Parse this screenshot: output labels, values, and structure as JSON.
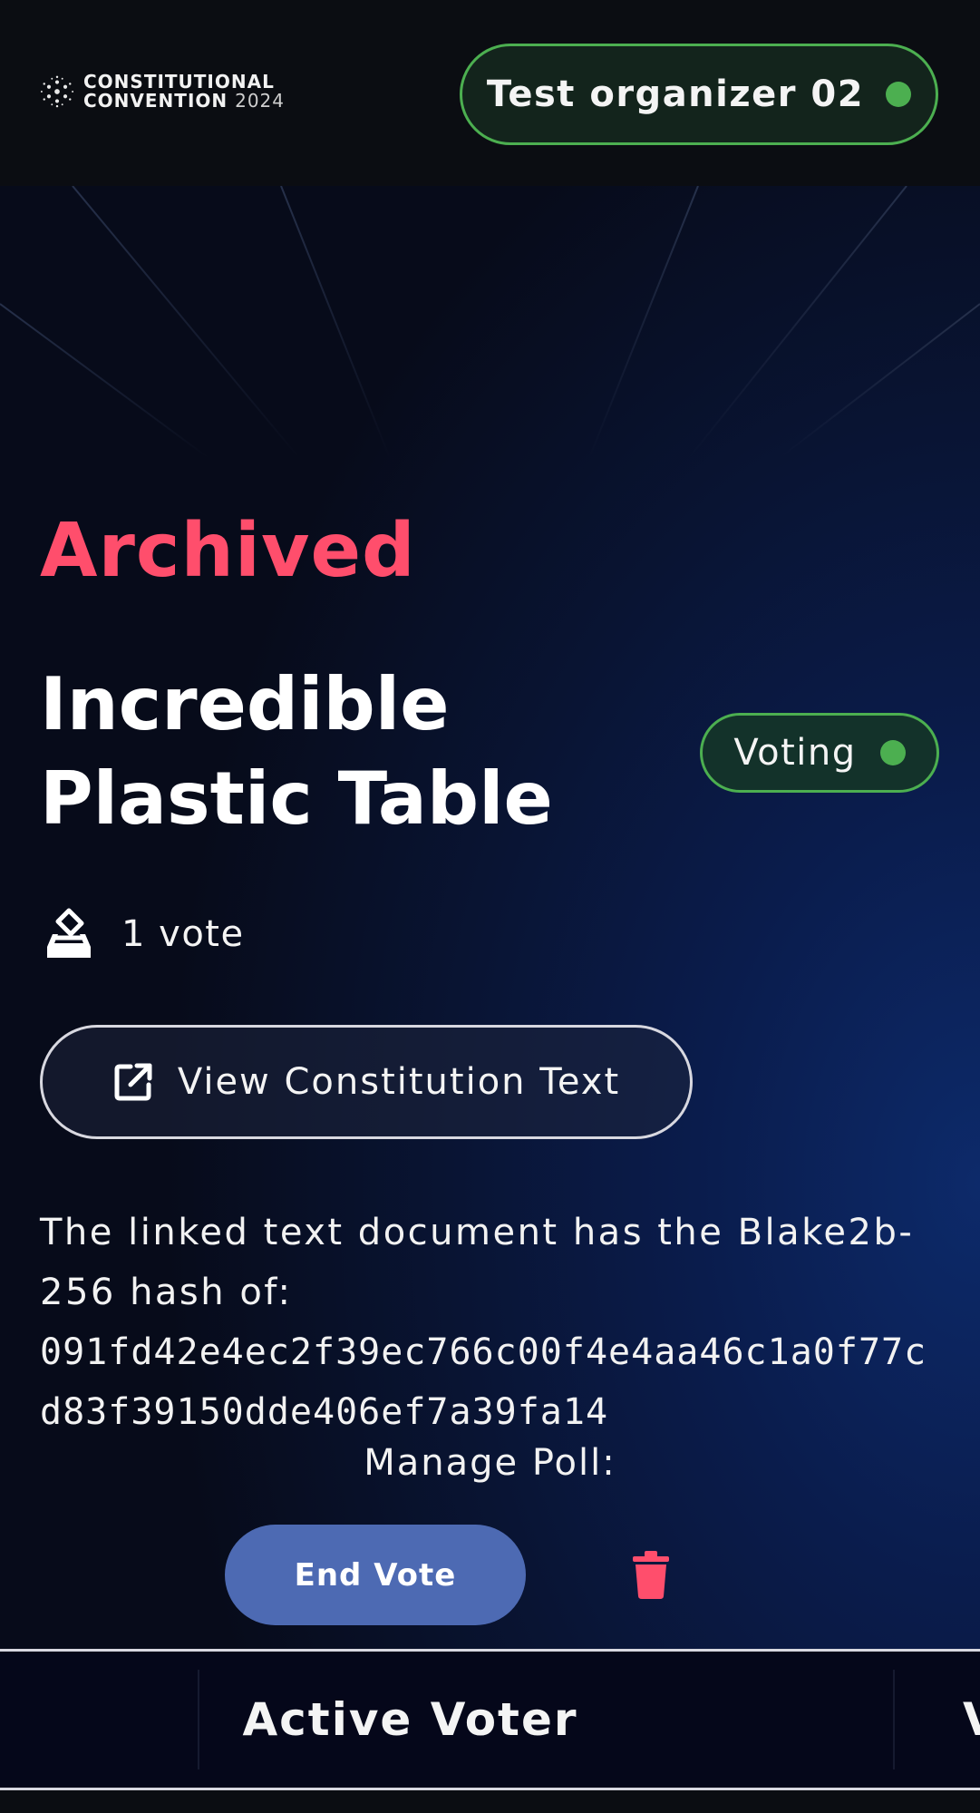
{
  "header": {
    "logo_line1": "CONSTITUTIONAL",
    "logo_line2": "CONVENTION",
    "logo_year": "2024",
    "organizer_name": "Test organizer 02",
    "status_color": "#4caf50"
  },
  "poll": {
    "state": "Archived",
    "title": "Incredible Plastic Table",
    "phase": "Voting",
    "vote_count": "1 vote",
    "view_button_label": "View Constitution Text",
    "hash_intro": "The linked text document has the Blake2b-256 hash of:",
    "hash_value": "091fd42e4ec2f39ec766c00f4e4aa46c1a0f77cd83f39150dde406ef7a39fa14"
  },
  "manage": {
    "label": "Manage Poll:",
    "end_vote_label": "End Vote"
  },
  "tabs": {
    "active": "Active Voter",
    "next": "V"
  },
  "colors": {
    "accent_red": "#ff4e6c",
    "accent_green": "#4caf50",
    "button_blue": "#4d6ab3",
    "background_dark": "#0b0d12"
  }
}
